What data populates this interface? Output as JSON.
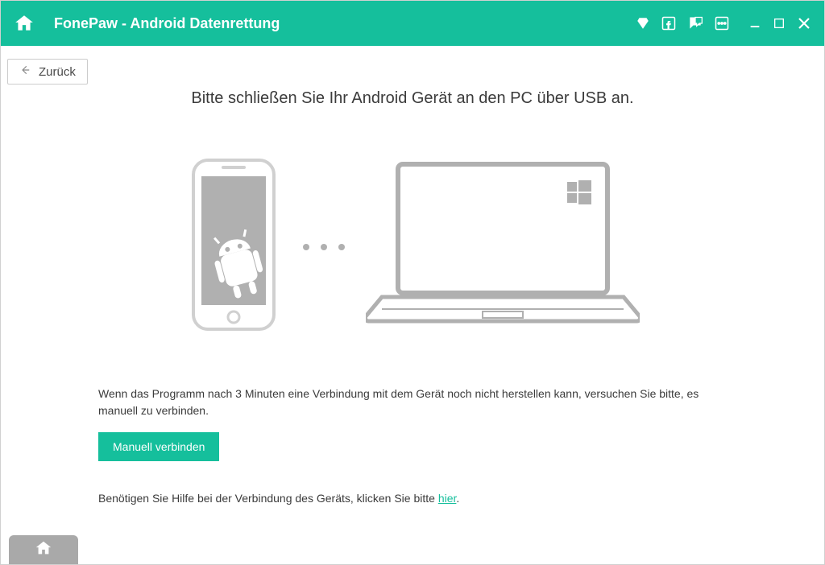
{
  "header": {
    "app_title": "FonePaw - Android Datenrettung",
    "icons": {
      "home": "home-icon",
      "diamond": "diamond-icon",
      "facebook": "facebook-icon",
      "feedback": "feedback-icon",
      "more": "more-icon",
      "minimize": "minimize-icon",
      "maximize": "maximize-icon",
      "close": "close-icon"
    }
  },
  "back_button": {
    "label": "Zurück"
  },
  "main": {
    "headline": "Bitte schließen Sie Ihr Android Gerät an den PC über USB an.",
    "instruction_text": "Wenn das Programm nach 3 Minuten eine Verbindung mit dem Gerät noch nicht herstellen kann, versuchen Sie bitte, es manuell zu verbinden.",
    "manual_button": "Manuell verbinden",
    "help_prefix": "Benötigen Sie Hilfe bei der Verbindung des Geräts, klicken Sie bitte ",
    "help_link": "hier",
    "help_suffix": "."
  },
  "footer": {
    "home": "home-icon"
  }
}
